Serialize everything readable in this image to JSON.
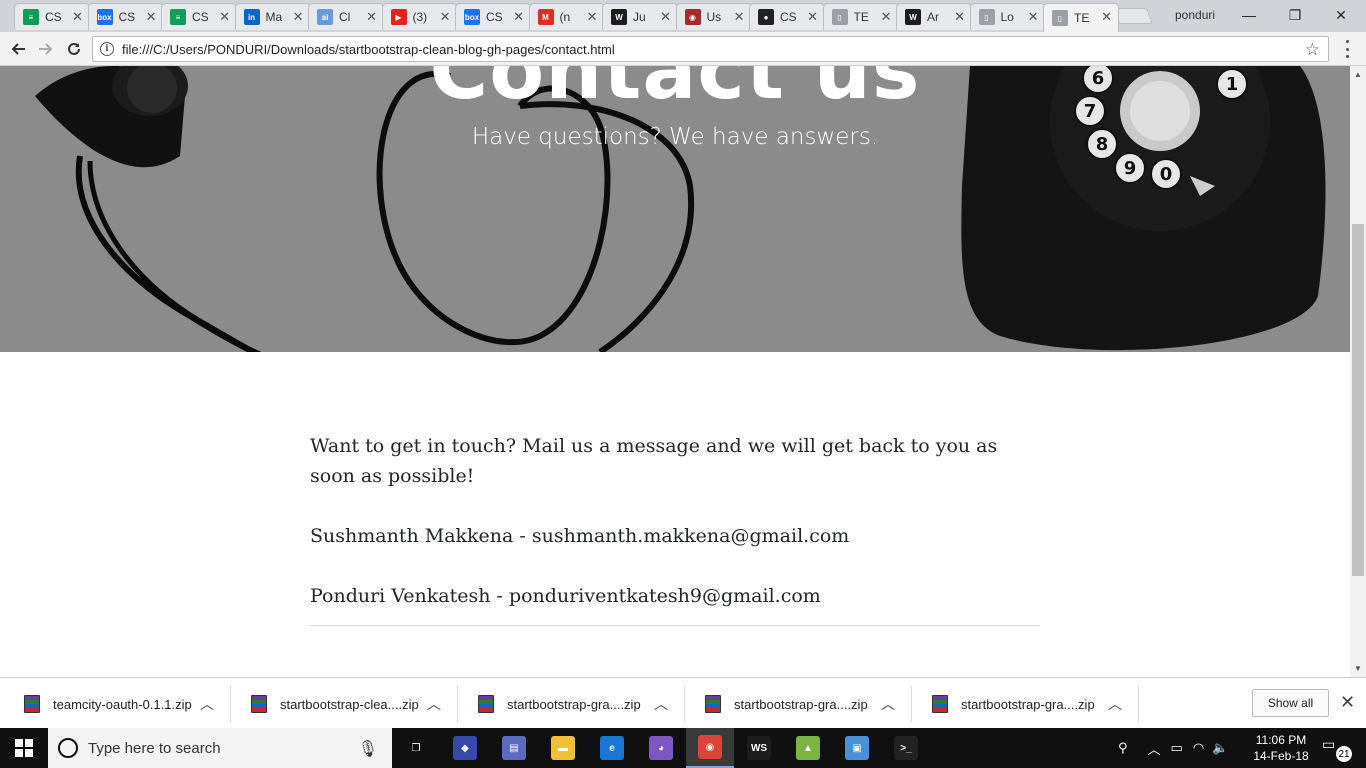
{
  "browser": {
    "tabs": [
      {
        "label": "CS",
        "icon": "sheets-icon",
        "color": "#0f9d58",
        "glyph": "≡"
      },
      {
        "label": "CS",
        "icon": "box-icon",
        "color": "#1a73e8",
        "glyph": "box"
      },
      {
        "label": "CS",
        "icon": "sheets-icon",
        "color": "#0f9d58",
        "glyph": "≡"
      },
      {
        "label": "Ma",
        "icon": "linkedin-icon",
        "color": "#0a66c2",
        "glyph": "in"
      },
      {
        "label": "Cl",
        "icon": "ai-icon",
        "color": "#6a9bd8",
        "glyph": "ai"
      },
      {
        "label": "(3)",
        "icon": "youtube-icon",
        "color": "#e62117",
        "glyph": "▶"
      },
      {
        "label": "CS",
        "icon": "box-icon",
        "color": "#1a73e8",
        "glyph": "box"
      },
      {
        "label": "(n",
        "icon": "gmail-icon",
        "color": "#d93025",
        "glyph": "M"
      },
      {
        "label": "Ju",
        "icon": "webstorm-icon",
        "color": "#1d1d1d",
        "glyph": "W"
      },
      {
        "label": "Us",
        "icon": "app-icon",
        "color": "#a52a2a",
        "glyph": "◉"
      },
      {
        "label": "CS",
        "icon": "github-icon",
        "color": "#222222",
        "glyph": "●"
      },
      {
        "label": "TE",
        "icon": "page-icon",
        "color": "#9aa0a6",
        "glyph": "▯"
      },
      {
        "label": "Ar",
        "icon": "webstorm-icon",
        "color": "#1d1d1d",
        "glyph": "W"
      },
      {
        "label": "Lo",
        "icon": "page-icon",
        "color": "#9aa0a6",
        "glyph": "▯"
      },
      {
        "label": "TE",
        "icon": "page-icon",
        "color": "#9aa0a6",
        "glyph": "▯",
        "active": true
      }
    ],
    "profile_name": "ponduri",
    "url": "file:///C:/Users/PONDURI/Downloads/startbootstrap-clean-blog-gh-pages/contact.html"
  },
  "page": {
    "hero_title": "Contact us",
    "hero_subtitle": "Have questions? We have answers.",
    "intro": "Want to get in touch? Mail us a message and we will get back to you as soon as possible!",
    "contacts": [
      "Sushmanth Makkena - sushmanth.makkena@gmail.com",
      "Ponduri Venkatesh - ponduriventkatesh9@gmail.com"
    ]
  },
  "downloads": {
    "items": [
      "teamcity-oauth-0.1.1.zip",
      "startbootstrap-clea....zip",
      "startbootstrap-gra....zip",
      "startbootstrap-gra....zip",
      "startbootstrap-gra....zip"
    ],
    "show_all_label": "Show all"
  },
  "taskbar": {
    "search_placeholder": "Type here to search",
    "apps": [
      {
        "name": "task-view",
        "color": "#101010",
        "glyph": "❐"
      },
      {
        "name": "app-blue",
        "color": "#3949ab",
        "glyph": "◆"
      },
      {
        "name": "app-monitor",
        "color": "#5c6bc0",
        "glyph": "▤"
      },
      {
        "name": "file-explorer",
        "color": "#f2c037",
        "glyph": "▬"
      },
      {
        "name": "edge",
        "color": "#1976d2",
        "glyph": "e"
      },
      {
        "name": "app-purple",
        "color": "#7e57c2",
        "glyph": "◕"
      },
      {
        "name": "chrome",
        "color": "#db4437",
        "glyph": "◉"
      },
      {
        "name": "webstorm",
        "color": "#1d1d1d",
        "glyph": "WS"
      },
      {
        "name": "android-studio",
        "color": "#7cb342",
        "glyph": "▲"
      },
      {
        "name": "app-frame",
        "color": "#4a90d9",
        "glyph": "▣"
      },
      {
        "name": "terminal",
        "color": "#222222",
        "glyph": ">_"
      }
    ],
    "time": "11:06 PM",
    "date": "14-Feb-18",
    "notifications": "21"
  }
}
